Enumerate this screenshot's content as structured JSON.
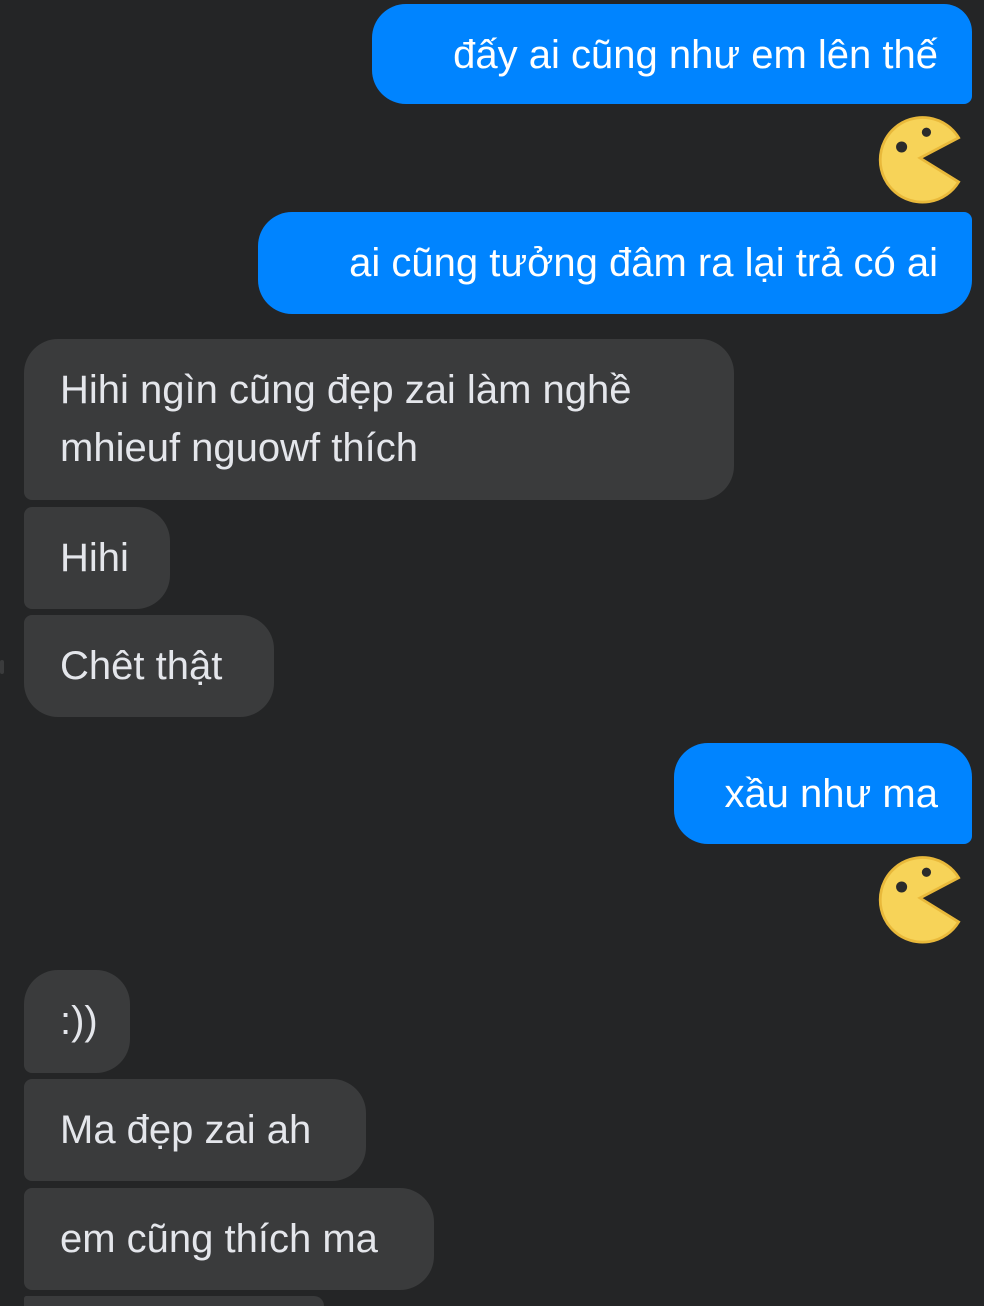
{
  "messages": {
    "m1": "đấy ai cũng như em lên thế",
    "m2": "ai cũng tưởng đâm ra lại trả có ai",
    "m3_line1": "Hihi ngìn cũng đẹp zai làm nghề",
    "m3_line2": "mhieuf nguowf thích",
    "m4": "Hihi",
    "m5": "Chêt thật",
    "m6": "xầu như ma",
    "m7": ":))",
    "m8": "Ma đẹp zai ah",
    "m9": "em cũng thích ma"
  },
  "stickers": [
    "pacman-sticker",
    "pacman-sticker"
  ],
  "colors": {
    "background": "#242526",
    "outgoing_bubble": "#0084ff",
    "incoming_bubble": "#3a3b3c",
    "sticker_fill": "#f7d358"
  }
}
